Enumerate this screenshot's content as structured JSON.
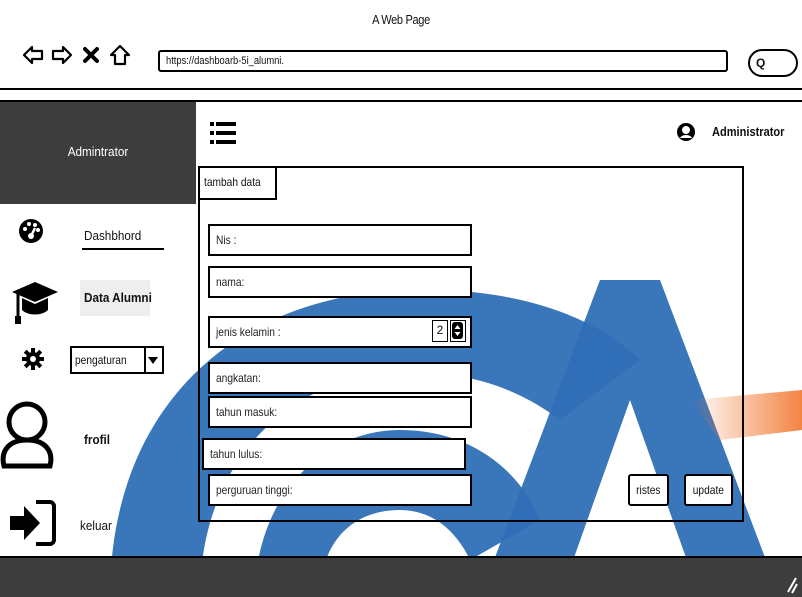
{
  "window": {
    "title": "A Web Page"
  },
  "browser": {
    "url": "https://dashboarb-5i_alumni.",
    "search_glyph": "Q"
  },
  "sidebar": {
    "title": "Admintrator",
    "items": [
      {
        "label": "Dashbhord",
        "icon": "dashboard-gauge-icon"
      },
      {
        "label": "Data Alumni",
        "icon": "graduation-cap-icon"
      },
      {
        "label": "pengaturan",
        "icon": "gear-icon"
      },
      {
        "label": "frofil",
        "icon": "user-profile-icon"
      },
      {
        "label": "keluar",
        "icon": "logout-icon"
      }
    ]
  },
  "header": {
    "user_name": "Administrator"
  },
  "panel": {
    "tab_label": "tambah data",
    "fields": {
      "nis": "Nis  :",
      "nama": "nama:",
      "jenis_kelamin": "jenis kelamin :",
      "jenis_kelamin_value": "2",
      "angkatan": "angkatan:",
      "tahun_masuk": "tahun masuk:",
      "tahun_lulus": "tahun lulus:",
      "perguruan_tinggi": "perguruan tinggi:"
    },
    "buttons": {
      "reset": "ristes",
      "update": "update"
    }
  },
  "colors": {
    "sidebar_header_bg": "#3d3d3d",
    "footer_bg": "#3d3d3d",
    "watermark_blue": "#2f6fb6",
    "watermark_orange": "#f2762e"
  }
}
